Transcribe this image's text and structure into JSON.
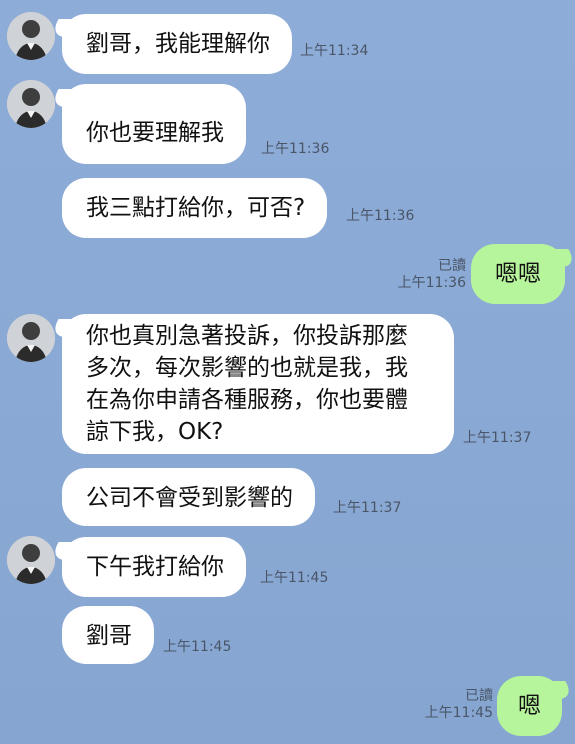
{
  "chat": {
    "messages": [
      {
        "text": "劉哥，我能理解你",
        "time": "上午11:34"
      },
      {
        "text": "你也要理解我",
        "time": "上午11:36"
      },
      {
        "text": "我三點打給你，可否?",
        "time": "上午11:36"
      },
      {
        "text": "嗯嗯",
        "read": "已讀",
        "time": "上午11:36"
      },
      {
        "line1": "你也真別急著投訴，你投訴那麼",
        "line2": "多次，每次影響的也就是我，我",
        "line3": "在為你申請各種服務，你也要體",
        "line4": "諒下我，OK?",
        "time": "上午11:37"
      },
      {
        "text": "公司不會受到影響的",
        "time": "上午11:37"
      },
      {
        "text": "下午我打給你",
        "time": "上午11:45"
      },
      {
        "text": "劉哥",
        "time": "上午11:45"
      },
      {
        "text": "嗯",
        "read": "已讀",
        "time": "上午11:45"
      }
    ]
  },
  "colors": {
    "background": "#8cabd6",
    "incoming_bubble": "#ffffff",
    "outgoing_bubble": "#b7f59d"
  },
  "icons": {
    "avatar": "avatar-icon"
  }
}
